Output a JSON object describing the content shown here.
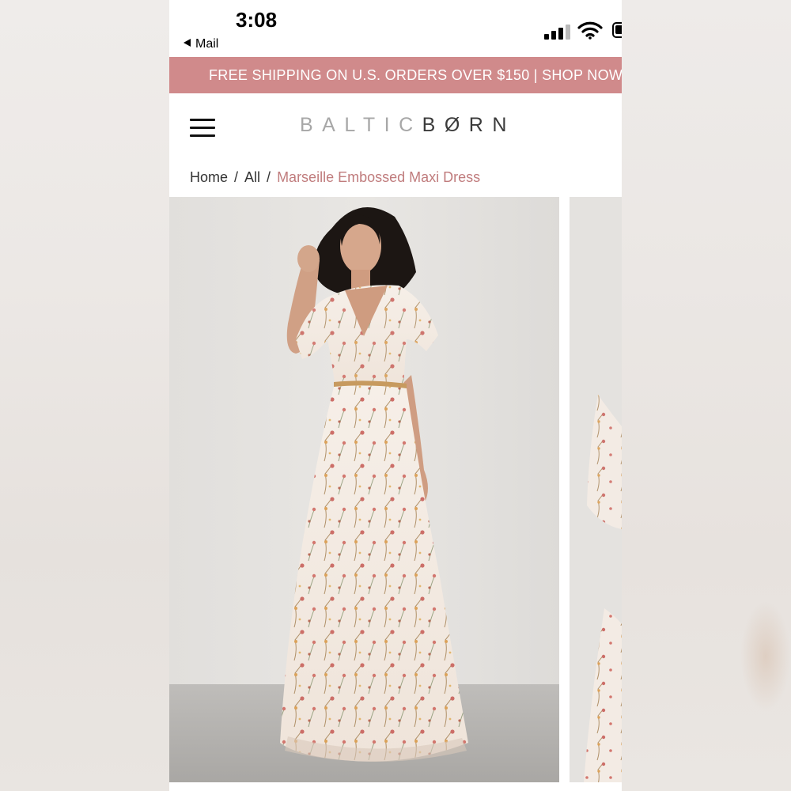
{
  "status_bar": {
    "time": "3:08",
    "back_label": "Mail"
  },
  "promo_banner": {
    "text": "FREE SHIPPING ON U.S. ORDERS OVER $150 | SHOP NOW"
  },
  "header": {
    "logo_part1": "BALTIC",
    "logo_part2": "BØRN"
  },
  "breadcrumb": {
    "items": [
      "Home",
      "All"
    ],
    "separator": "/",
    "current": "Marseille Embossed Maxi Dress"
  },
  "colors": {
    "promo_bg": "#d08a8b",
    "breadcrumb_current": "#c07c7d"
  },
  "icons": {
    "menu": "hamburger-icon",
    "signal": "cellular-signal-icon",
    "wifi": "wifi-icon",
    "battery": "battery-icon",
    "back": "back-triangle-icon"
  }
}
